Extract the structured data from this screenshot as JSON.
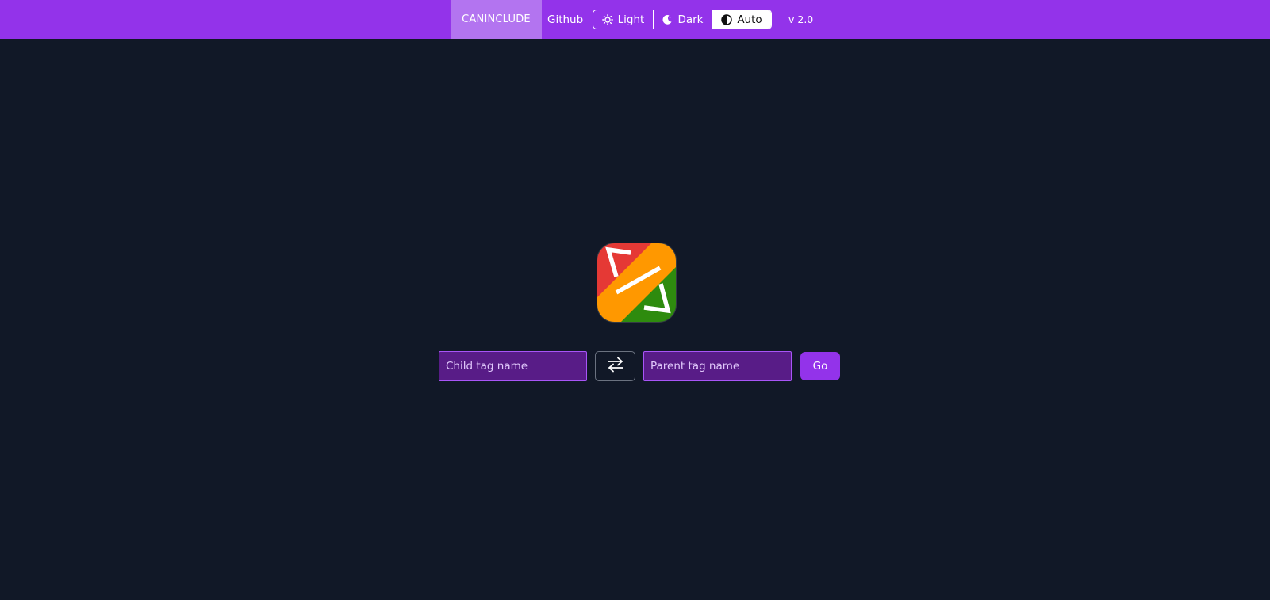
{
  "header": {
    "brand": "CANINCLUDE",
    "github_label": "Github",
    "theme_options": [
      {
        "label": "Light",
        "icon": "sun-icon"
      },
      {
        "label": "Dark",
        "icon": "moon-icon"
      },
      {
        "label": "Auto",
        "icon": "half-circle-icon",
        "selected": true
      }
    ],
    "version": "v 2.0"
  },
  "logo": {
    "icon": "code-tag-logo",
    "colors": [
      "#e53935",
      "#ff9800",
      "#2e8b0e"
    ]
  },
  "search": {
    "child_placeholder": "Child tag name",
    "child_value": "",
    "swap_icon": "swap-arrows-icon",
    "parent_placeholder": "Parent tag name",
    "parent_value": "",
    "go_label": "Go"
  },
  "colors": {
    "accent": "#9333ea",
    "background": "#111827",
    "input_background": "#581c87"
  }
}
